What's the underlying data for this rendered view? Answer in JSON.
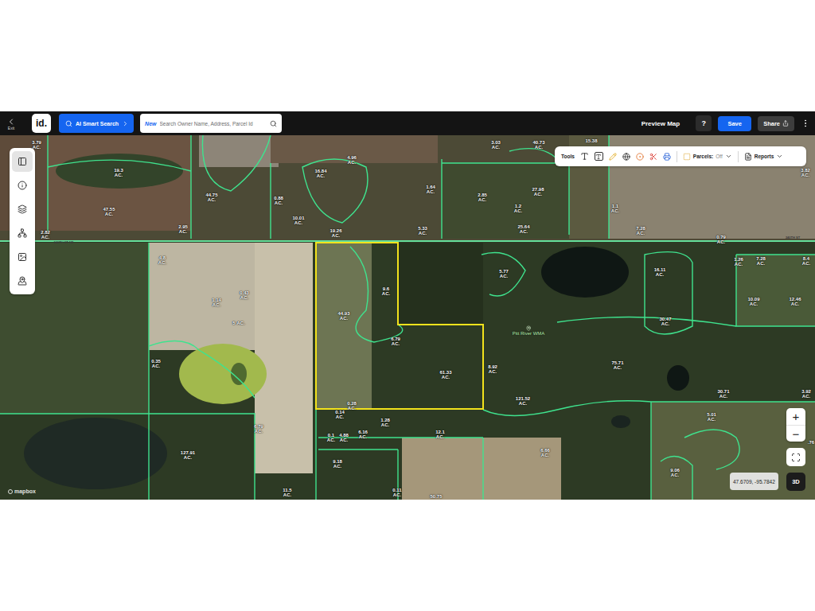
{
  "header": {
    "exit": "Exit",
    "logo": "id.",
    "ai_search": "AI Smart Search",
    "search": {
      "badge": "New",
      "placeholder": "Search Owner Name, Address, Parcel Id"
    },
    "preview": "Preview Map",
    "help": "?",
    "save": "Save",
    "share": "Share"
  },
  "rail": [
    {
      "selected": true
    },
    {
      "selected": false
    },
    {
      "selected": false
    },
    {
      "selected": false
    },
    {
      "selected": false
    },
    {
      "selected": false
    }
  ],
  "toolbar": {
    "tools": "Tools",
    "parcels_label": "Parcels:",
    "parcels_value": "Off",
    "reports": "Reports"
  },
  "map": {
    "parcels": [
      {
        "value": "3.79",
        "unit": "AC.",
        "kind": "stacked",
        "selected": false
      },
      {
        "value": "19.3",
        "unit": "AC.",
        "kind": "stacked",
        "selected": false
      },
      {
        "value": "47.55",
        "unit": "AC.",
        "kind": "stacked",
        "selected": false
      },
      {
        "value": "44.75",
        "unit": "AC.",
        "kind": "stacked",
        "selected": false
      },
      {
        "value": "2.95",
        "unit": "AC.",
        "kind": "stacked",
        "selected": false
      },
      {
        "value": "2.82",
        "unit": "AC.",
        "kind": "stacked",
        "selected": false
      },
      {
        "value": "16.84",
        "unit": "AC.",
        "kind": "stacked",
        "selected": false
      },
      {
        "value": "4.96",
        "unit": "AC.",
        "kind": "stacked",
        "selected": false
      },
      {
        "value": "0.88",
        "unit": "AC.",
        "kind": "stacked",
        "selected": false
      },
      {
        "value": "10.01",
        "unit": "AC.",
        "kind": "stacked",
        "selected": false
      },
      {
        "value": "19.26",
        "unit": "AC.",
        "kind": "stacked",
        "selected": false
      },
      {
        "value": "1.64",
        "unit": "AC.",
        "kind": "stacked",
        "selected": false
      },
      {
        "value": "5.33",
        "unit": "AC.",
        "kind": "stacked",
        "selected": false
      },
      {
        "value": "3.03",
        "unit": "AC.",
        "kind": "stacked",
        "selected": false
      },
      {
        "value": "40.73",
        "unit": "AC.",
        "kind": "stacked",
        "selected": false
      },
      {
        "value": "15.38",
        "kind": "value-only",
        "selected": false
      },
      {
        "value": "2.85",
        "unit": "AC.",
        "kind": "stacked",
        "selected": false
      },
      {
        "value": "27.98",
        "unit": "AC.",
        "kind": "stacked",
        "selected": false
      },
      {
        "value": "1.2",
        "unit": "AC.",
        "kind": "stacked",
        "selected": false
      },
      {
        "value": "25.64",
        "unit": "AC.",
        "kind": "stacked",
        "selected": false
      },
      {
        "value": "1.1",
        "unit": "AC.",
        "kind": "stacked",
        "selected": false
      },
      {
        "value": "7.28",
        "unit": "AC.",
        "kind": "stacked",
        "selected": false
      },
      {
        "value": "0.79",
        "unit": "AC.",
        "kind": "stacked",
        "selected": false
      },
      {
        "value": "3.82",
        "unit": "AC.",
        "kind": "stacked",
        "selected": false
      },
      {
        "value": "4.8",
        "unit": "AC.",
        "kind": "stacked",
        "selected": false
      },
      {
        "value": "1.14",
        "unit": "AC.",
        "kind": "stacked",
        "selected": false
      },
      {
        "value": "0.43",
        "unit": "AC.",
        "kind": "stacked",
        "selected": false
      },
      {
        "value": "5",
        "unit": "AC.",
        "kind": "inline",
        "selected": false
      },
      {
        "value": "0.35",
        "unit": "AC.",
        "kind": "stacked",
        "selected": false
      },
      {
        "value": "6.79",
        "unit": "AC.",
        "kind": "stacked",
        "selected": false
      },
      {
        "value": "127.91",
        "unit": "AC.",
        "kind": "stacked",
        "selected": false
      },
      {
        "value": "11.5",
        "unit": "AC.",
        "kind": "stacked",
        "selected": false
      },
      {
        "value": "44.93",
        "unit": "AC.",
        "kind": "stacked",
        "selected": true
      },
      {
        "value": "9.6",
        "unit": "AC.",
        "kind": "stacked",
        "selected": true
      },
      {
        "value": "6.79",
        "unit": "AC.",
        "kind": "stacked",
        "selected": true
      },
      {
        "value": "61.33",
        "unit": "AC.",
        "kind": "stacked",
        "selected": true
      },
      {
        "value": "0.28",
        "unit": "AC.",
        "kind": "stacked",
        "selected": false
      },
      {
        "value": "0.14",
        "unit": "AC.",
        "kind": "stacked",
        "selected": false
      },
      {
        "value": "1.28",
        "unit": "AC.",
        "kind": "stacked",
        "selected": false
      },
      {
        "value": "0.1",
        "unit": "AC.",
        "kind": "stacked",
        "selected": false
      },
      {
        "value": "4.88",
        "unit": "AC.",
        "kind": "stacked",
        "selected": false
      },
      {
        "value": "6.16",
        "unit": "AC.",
        "kind": "stacked",
        "selected": false
      },
      {
        "value": "12.1",
        "unit": "AC.",
        "kind": "stacked",
        "selected": false
      },
      {
        "value": "9.18",
        "unit": "AC.",
        "kind": "stacked",
        "selected": false
      },
      {
        "value": "0.11",
        "unit": "AC.",
        "kind": "stacked",
        "selected": false
      },
      {
        "value": "50.75",
        "kind": "value-only",
        "selected": false
      },
      {
        "value": "6.66",
        "unit": "AC.",
        "kind": "stacked",
        "selected": false
      },
      {
        "value": "5.77",
        "unit": "AC.",
        "kind": "stacked",
        "selected": false
      },
      {
        "value": "16.11",
        "unit": "AC.",
        "kind": "stacked",
        "selected": false
      },
      {
        "value": "30.47",
        "unit": "AC.",
        "kind": "stacked",
        "selected": false
      },
      {
        "value": "1.26",
        "unit": "AC.",
        "kind": "stacked",
        "selected": false
      },
      {
        "value": "7.28",
        "unit": "AC.",
        "kind": "stacked",
        "selected": false
      },
      {
        "value": "8.4",
        "unit": "AC.",
        "kind": "stacked",
        "selected": false
      },
      {
        "value": "10.09",
        "unit": "AC.",
        "kind": "stacked",
        "selected": false
      },
      {
        "value": "12.46",
        "unit": "AC.",
        "kind": "stacked",
        "selected": false
      },
      {
        "value": "75.71",
        "unit": "AC.",
        "kind": "stacked",
        "selected": false
      },
      {
        "value": "30.71",
        "unit": "AC.",
        "kind": "stacked",
        "selected": false
      },
      {
        "value": "3.92",
        "unit": "AC.",
        "kind": "stacked",
        "selected": false
      },
      {
        "value": "5.01",
        "unit": "AC.",
        "kind": "stacked",
        "selected": false
      },
      {
        "value": "121.52",
        "unit": "AC.",
        "kind": "stacked",
        "selected": false
      },
      {
        "value": "8.92",
        "unit": "AC.",
        "kind": "stacked",
        "selected": false
      },
      {
        "value": "9.06",
        "unit": "AC.",
        "kind": "stacked",
        "selected": false
      },
      {
        "value": ".76",
        "kind": "value-only",
        "selected": false
      }
    ],
    "places": [
      {
        "name": "Pitt River WMA"
      }
    ],
    "roads": [
      {
        "name": "240TH ST NE"
      },
      {
        "name": "240TH ST"
      }
    ],
    "zoom_in": "+",
    "zoom_out": "−",
    "coordinates": "47.6709, -95.7842",
    "view_toggle": "3D",
    "attribution": "mapbox"
  }
}
